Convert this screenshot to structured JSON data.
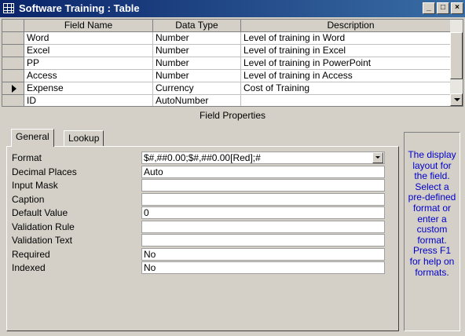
{
  "window": {
    "title": "Software Training : Table",
    "minimize_label": "_",
    "restore_label": "□",
    "close_label": "×"
  },
  "grid": {
    "columns": [
      "Field Name",
      "Data Type",
      "Description"
    ],
    "rows": [
      {
        "field_name": "Word",
        "data_type": "Number",
        "description": "Level of training in Word",
        "current": false
      },
      {
        "field_name": "Excel",
        "data_type": "Number",
        "description": "Level of training in Excel",
        "current": false
      },
      {
        "field_name": "PP",
        "data_type": "Number",
        "description": "Level of training in PowerPoint",
        "current": false
      },
      {
        "field_name": "Access",
        "data_type": "Number",
        "description": "Level of training in Access",
        "current": false
      },
      {
        "field_name": "Expense",
        "data_type": "Currency",
        "description": "Cost of Training",
        "current": true
      },
      {
        "field_name": "ID",
        "data_type": "AutoNumber",
        "description": "",
        "current": false
      }
    ]
  },
  "field_properties": {
    "title": "Field Properties",
    "tabs": [
      "General",
      "Lookup"
    ],
    "active_tab": "General",
    "properties": [
      {
        "label": "Format",
        "value": "$#,##0.00;$#,##0.00[Red];#",
        "has_dropdown": true
      },
      {
        "label": "Decimal Places",
        "value": "Auto",
        "has_dropdown": false
      },
      {
        "label": "Input Mask",
        "value": "",
        "has_dropdown": false
      },
      {
        "label": "Caption",
        "value": "",
        "has_dropdown": false
      },
      {
        "label": "Default Value",
        "value": "0",
        "has_dropdown": false
      },
      {
        "label": "Validation Rule",
        "value": "",
        "has_dropdown": false
      },
      {
        "label": "Validation Text",
        "value": "",
        "has_dropdown": false
      },
      {
        "label": "Required",
        "value": "No",
        "has_dropdown": false
      },
      {
        "label": "Indexed",
        "value": "No",
        "has_dropdown": false
      }
    ],
    "help_text": "The display layout for the field. Select a pre-defined format or enter a custom format. Press F1 for help on formats."
  },
  "colors": {
    "title_bar": "#0a246a",
    "help_text": "#0000cc",
    "face": "#d4d0c8"
  }
}
